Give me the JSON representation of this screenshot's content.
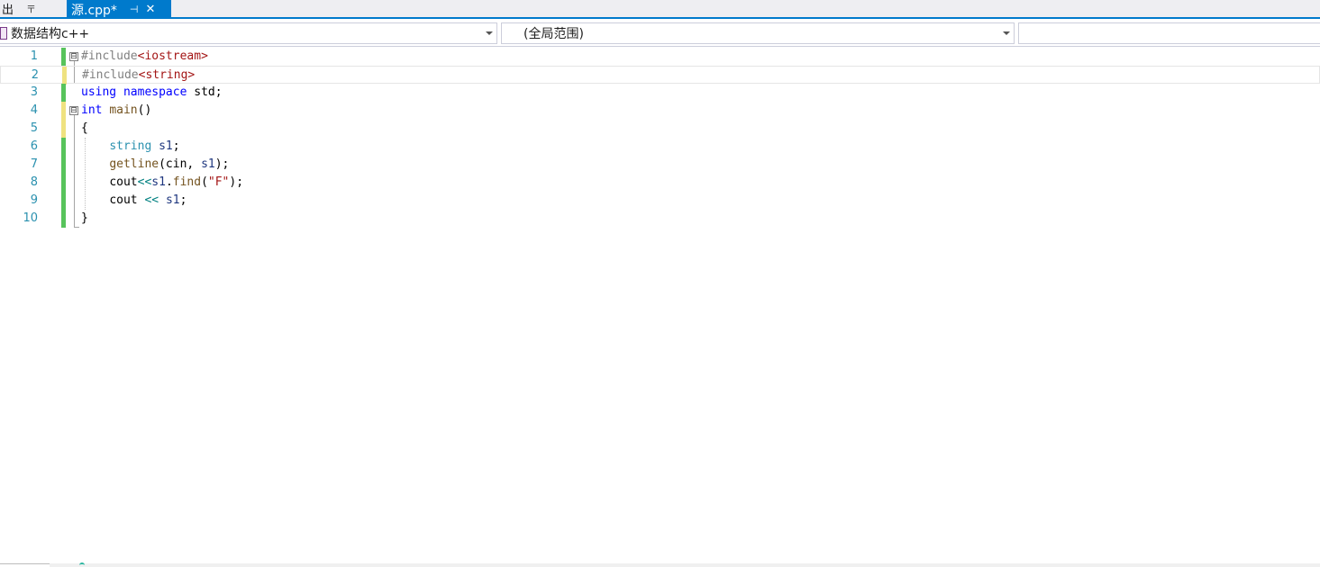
{
  "tabs": {
    "output_label": "出",
    "output_pin": "〒",
    "active_label": "源.cpp*",
    "active_pin": "⊣",
    "active_close": "✕"
  },
  "navbar": {
    "project": "数据结构c++",
    "scope": "(全局范围)",
    "member": ""
  },
  "editor": {
    "line_numbers": [
      "1",
      "2",
      "3",
      "4",
      "5",
      "6",
      "7",
      "8",
      "9",
      "10"
    ],
    "current_line": 2,
    "lines": [
      [
        {
          "t": "#include",
          "c": "pp"
        },
        {
          "t": "<iostream>",
          "c": "str"
        }
      ],
      [
        {
          "t": "#include",
          "c": "pp"
        },
        {
          "t": "<string>",
          "c": "str"
        }
      ],
      [
        {
          "t": "using",
          "c": "kw"
        },
        {
          "t": " ",
          "c": "plain"
        },
        {
          "t": "namespace",
          "c": "kw"
        },
        {
          "t": " std;",
          "c": "plain"
        }
      ],
      [
        {
          "t": "int",
          "c": "kw"
        },
        {
          "t": " ",
          "c": "plain"
        },
        {
          "t": "main",
          "c": "fn"
        },
        {
          "t": "()",
          "c": "plain"
        }
      ],
      [
        {
          "t": "{",
          "c": "plain"
        }
      ],
      [
        {
          "t": "    ",
          "c": "plain"
        },
        {
          "t": "string",
          "c": "type"
        },
        {
          "t": " ",
          "c": "plain"
        },
        {
          "t": "s1",
          "c": "var"
        },
        {
          "t": ";",
          "c": "plain"
        }
      ],
      [
        {
          "t": "    ",
          "c": "plain"
        },
        {
          "t": "getline",
          "c": "fn"
        },
        {
          "t": "(cin, ",
          "c": "plain"
        },
        {
          "t": "s1",
          "c": "var"
        },
        {
          "t": ");",
          "c": "plain"
        }
      ],
      [
        {
          "t": "    ",
          "c": "plain"
        },
        {
          "t": "cout",
          "c": "plain"
        },
        {
          "t": "<<",
          "c": "op"
        },
        {
          "t": "s1",
          "c": "var"
        },
        {
          "t": ".",
          "c": "plain"
        },
        {
          "t": "find",
          "c": "fn"
        },
        {
          "t": "(",
          "c": "plain"
        },
        {
          "t": "\"F\"",
          "c": "str"
        },
        {
          "t": ");",
          "c": "plain"
        }
      ],
      [
        {
          "t": "    ",
          "c": "plain"
        },
        {
          "t": "cout",
          "c": "plain"
        },
        {
          "t": " ",
          "c": "plain"
        },
        {
          "t": "<<",
          "c": "op"
        },
        {
          "t": " ",
          "c": "plain"
        },
        {
          "t": "s1",
          "c": "var"
        },
        {
          "t": ";",
          "c": "plain"
        }
      ],
      [
        {
          "t": "}",
          "c": "plain"
        }
      ]
    ],
    "change_markers": [
      "saved",
      "unsaved",
      "saved",
      "unsaved",
      "unsaved",
      "saved",
      "saved",
      "saved",
      "saved",
      "saved"
    ]
  },
  "colors": {
    "accent": "#007acc",
    "unsaved_change": "#efe280",
    "saved_change": "#57c35b",
    "line_number": "#2b91af",
    "keyword": "#0000ff",
    "string": "#a31515",
    "preprocessor": "#808080"
  },
  "icons": {
    "fold_collapse": "⊟",
    "project": "project-icon",
    "dropdown": "chevron-down-icon"
  }
}
